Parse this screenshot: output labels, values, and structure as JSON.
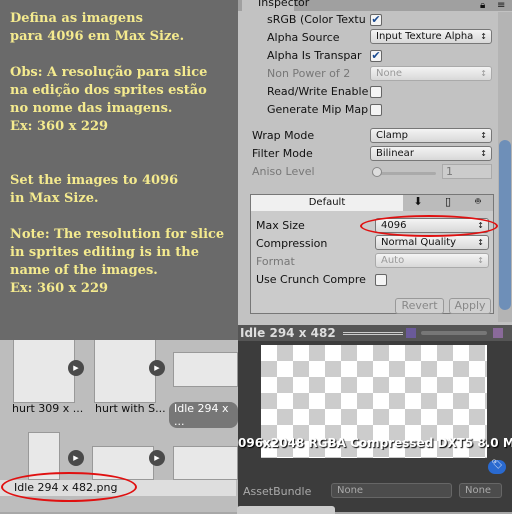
{
  "note": {
    "pt": [
      "Defina as imagens",
      "para 4096 em Max Size."
    ],
    "pt_obs": [
      "Obs: A resolução para slice",
      "na edição dos sprites estão",
      "no nome das imagens.",
      "Ex: 360 x 229"
    ],
    "en": [
      "Set the images to 4096",
      "in Max Size."
    ],
    "en_obs": [
      "Note: The resolution for slice",
      "in sprites editing is in the",
      "name of the images.",
      "Ex: 360 x 229"
    ]
  },
  "project": {
    "items": [
      "hurt 309 x ...",
      "hurt with S...",
      "Idle 294 x ..."
    ],
    "selected_path": "Idle 294 x 482.png"
  },
  "inspector": {
    "tab": "Inspector",
    "srgb": "sRGB (Color Textu",
    "alpha_source": "Alpha Source",
    "alpha_source_value": "Input Texture Alpha",
    "alpha_transparency": "Alpha Is Transpar",
    "non_power": "Non Power of 2",
    "non_power_value": "None",
    "read_write": "Read/Write Enable",
    "mipmaps": "Generate Mip Map",
    "wrap_mode": "Wrap Mode",
    "wrap_value": "Clamp",
    "filter_mode": "Filter Mode",
    "filter_value": "Bilinear",
    "aniso": "Aniso Level",
    "aniso_value": "1",
    "platform_tab": "Default",
    "max_size": "Max Size",
    "max_size_value": "4096",
    "compression": "Compression",
    "compression_value": "Normal Quality",
    "format": "Format",
    "format_value": "Auto",
    "crunch": "Use Crunch Compre",
    "revert": "Revert",
    "apply": "Apply"
  },
  "preview": {
    "title": "Idle 294 x 482",
    "info": "096x2048  RGBA Compressed DXT5   8.0 M",
    "assetbundle": "AssetBundle",
    "bundle_value": "None",
    "variant_value": "None"
  }
}
